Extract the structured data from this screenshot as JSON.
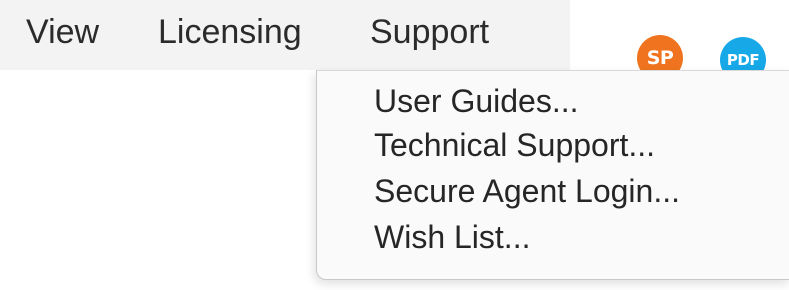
{
  "menubar": {
    "items": [
      "View",
      "Licensing",
      "Support"
    ]
  },
  "badges": {
    "sp_label": "SP",
    "pdf_label": "PDF",
    "sp_color": "#f0741f",
    "pdf_color": "#17a8e8"
  },
  "support_menu": {
    "items": [
      "User Guides...",
      "Technical Support...",
      "Secure Agent Login...",
      "Wish List..."
    ]
  }
}
